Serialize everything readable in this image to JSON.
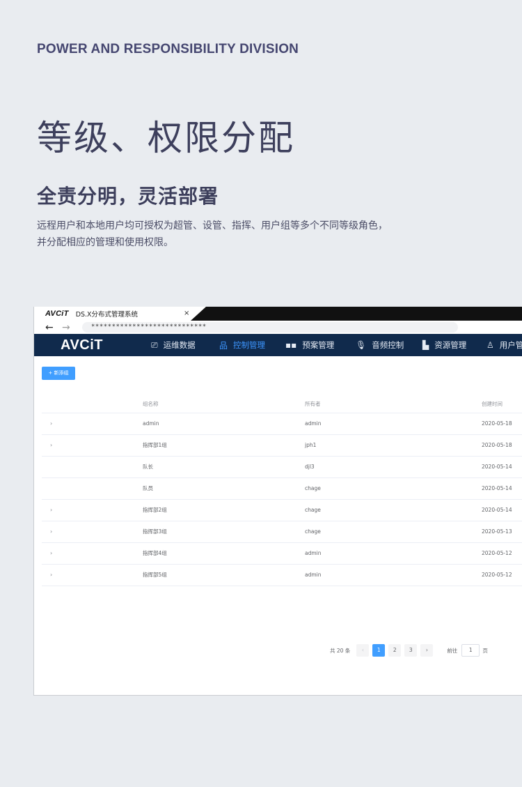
{
  "eyebrow": "POWER AND RESPONSIBILITY DIVISION",
  "headline": "等级、权限分配",
  "subheadline": "全责分明，灵活部署",
  "description_lines": [
    "远程用户和本地用户均可授权为超管、设管、指挥、用户组等多个不同等级角色，",
    "并分配相应的管理和使用权限。"
  ],
  "browser": {
    "tab_logo": "AVCiT",
    "tab_title": "DS.X分布式管理系统",
    "tab_close": "×",
    "back": "←",
    "forward": "→",
    "url": "****************************"
  },
  "app": {
    "logo": "AVCiT",
    "nav": [
      {
        "icon": "presentation-icon",
        "glyph": "⎚",
        "label": "运维数据",
        "active": false
      },
      {
        "icon": "network-icon",
        "glyph": "品",
        "label": "控制管理",
        "active": true
      },
      {
        "icon": "grid-icon",
        "glyph": "▪▪",
        "label": "预案管理",
        "active": false
      },
      {
        "icon": "microphone-icon",
        "glyph": "🎙",
        "label": "音频控制",
        "active": false
      },
      {
        "icon": "stack-icon",
        "glyph": "▙",
        "label": "资源管理",
        "active": false
      },
      {
        "icon": "user-gear-icon",
        "glyph": "♙",
        "label": "用户管理",
        "active": false
      }
    ],
    "add_button": "+ 新添组",
    "columns": [
      "组名称",
      "所有者",
      "创建时间"
    ],
    "rows": [
      {
        "expand": "›",
        "name": "admin",
        "owner": "admin",
        "date": "2020-05-18"
      },
      {
        "expand": "›",
        "name": "指挥部1组",
        "owner": "jph1",
        "date": "2020-05-18"
      },
      {
        "expand": "",
        "name": "队长",
        "owner": "djl3",
        "date": "2020-05-14"
      },
      {
        "expand": "",
        "name": "队员",
        "owner": "chage",
        "date": "2020-05-14"
      },
      {
        "expand": "›",
        "name": "指挥部2组",
        "owner": "chage",
        "date": "2020-05-14"
      },
      {
        "expand": "›",
        "name": "指挥部3组",
        "owner": "chage",
        "date": "2020-05-13"
      },
      {
        "expand": "›",
        "name": "指挥部4组",
        "owner": "admin",
        "date": "2020-05-12"
      },
      {
        "expand": "›",
        "name": "指挥部5组",
        "owner": "admin",
        "date": "2020-05-12"
      }
    ],
    "pagination": {
      "total": "共 20 条",
      "prev": "‹",
      "pages": [
        "1",
        "2",
        "3"
      ],
      "current": "1",
      "next": "›",
      "goto_label": "前往",
      "goto_value": "1",
      "goto_suffix": "页"
    }
  },
  "colors": {
    "background": "#e9ecf0",
    "heading": "#3d3f5c",
    "nav_bg": "#102a4c",
    "accent": "#409eff"
  }
}
